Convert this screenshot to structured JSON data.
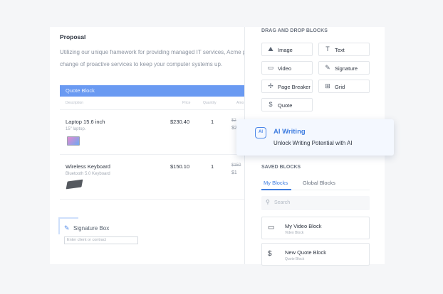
{
  "document": {
    "title": "Proposal",
    "body_line1": "Utilizing our unique framework for providing managed IT services, Acme  p",
    "body_line2": "change of proactive services to keep your computer systems up."
  },
  "quote_block": {
    "header": "Quote Block",
    "columns": [
      "Description",
      "Price",
      "Quantity",
      "Amo"
    ],
    "rows": [
      {
        "name": "Laptop 15.6 inch",
        "sub": "15\" laptop.",
        "price": "$230.40",
        "qty": "1",
        "amount_old": "$2",
        "amount": "$2"
      },
      {
        "name": "Wireless Keyboard",
        "sub": "Bluetooth 5.0 Keyboard",
        "price": "$150.10",
        "qty": "1",
        "amount_old": "$150",
        "amount": "$1"
      }
    ]
  },
  "signature_box": {
    "label": "Signature Box",
    "placeholder": "Enter client or contract"
  },
  "panel": {
    "title": "DRAG AND DROP BLOCKS",
    "blocks": [
      {
        "label": "Image",
        "icon": "image-icon",
        "glyph": "⛰"
      },
      {
        "label": "Text",
        "icon": "text-icon",
        "glyph": "T"
      },
      {
        "label": "Video",
        "icon": "video-icon",
        "glyph": "▭"
      },
      {
        "label": "Signature",
        "icon": "signature-icon",
        "glyph": "✎"
      },
      {
        "label": "Page Breaker",
        "icon": "page-breaker-icon",
        "glyph": "✢"
      },
      {
        "label": "Grid",
        "icon": "grid-icon",
        "glyph": "⊞"
      },
      {
        "label": "Quote",
        "icon": "dollar-icon",
        "glyph": "$"
      }
    ],
    "saved_title": "SAVED BLOCKS",
    "tabs": [
      "My Blocks",
      "Global Blocks"
    ],
    "search_placeholder": "Search",
    "saved_items": [
      {
        "title": "My Video Block",
        "sub": "Video Block",
        "icon": "video-icon"
      },
      {
        "title": "New Quote Block",
        "sub": "Quote Block",
        "icon": "dollar-icon"
      }
    ]
  },
  "ai_card": {
    "title": "AI Writing",
    "description": "Unlock Writing Potential with AI",
    "icon_text": "AI"
  },
  "colors": {
    "accent": "#3f7de0",
    "quote_header": "#6a9af2",
    "ai_card_bg": "#f4f8ff"
  }
}
